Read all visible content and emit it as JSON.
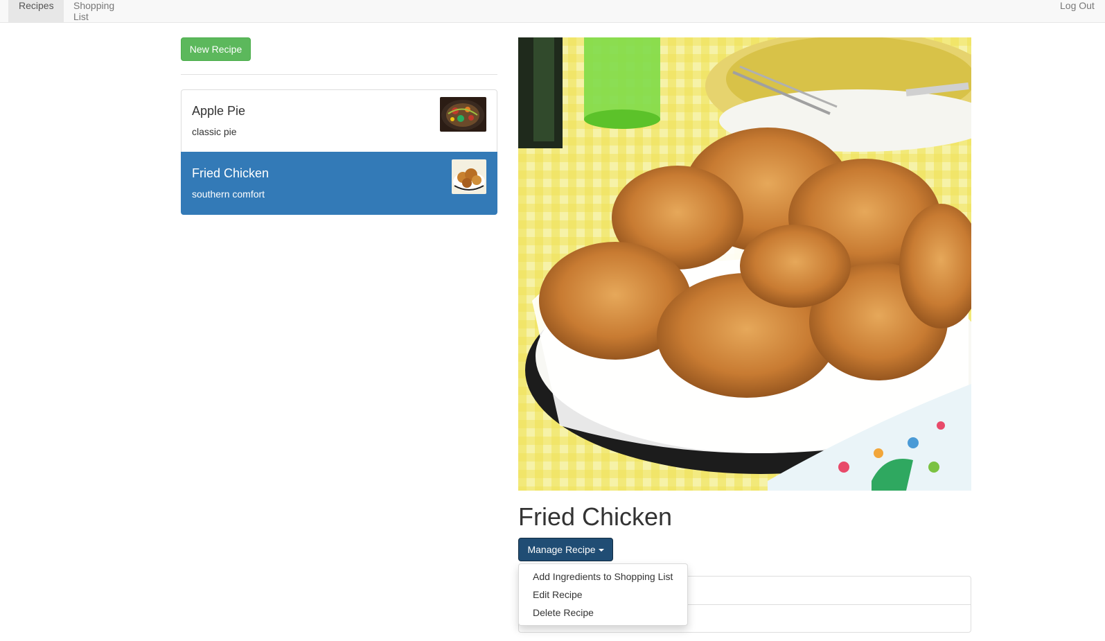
{
  "navbar": {
    "tabs": [
      {
        "label": "Recipes",
        "active": true
      },
      {
        "label": "Shopping List",
        "active": false
      }
    ],
    "logout_label": "Log Out"
  },
  "sidebar": {
    "new_recipe_label": "New Recipe",
    "recipes": [
      {
        "name": "Apple Pie",
        "description": "classic pie",
        "active": false
      },
      {
        "name": "Fried Chicken",
        "description": "southern comfort",
        "active": true
      }
    ]
  },
  "detail": {
    "title": "Fried Chicken",
    "manage_label": "Manage Recipe",
    "menu": [
      "Add Ingredients to Shopping List",
      "Edit Recipe",
      "Delete Recipe"
    ]
  },
  "colors": {
    "primary": "#337ab7",
    "success": "#5cb85c",
    "manage_button": "#204d74"
  }
}
